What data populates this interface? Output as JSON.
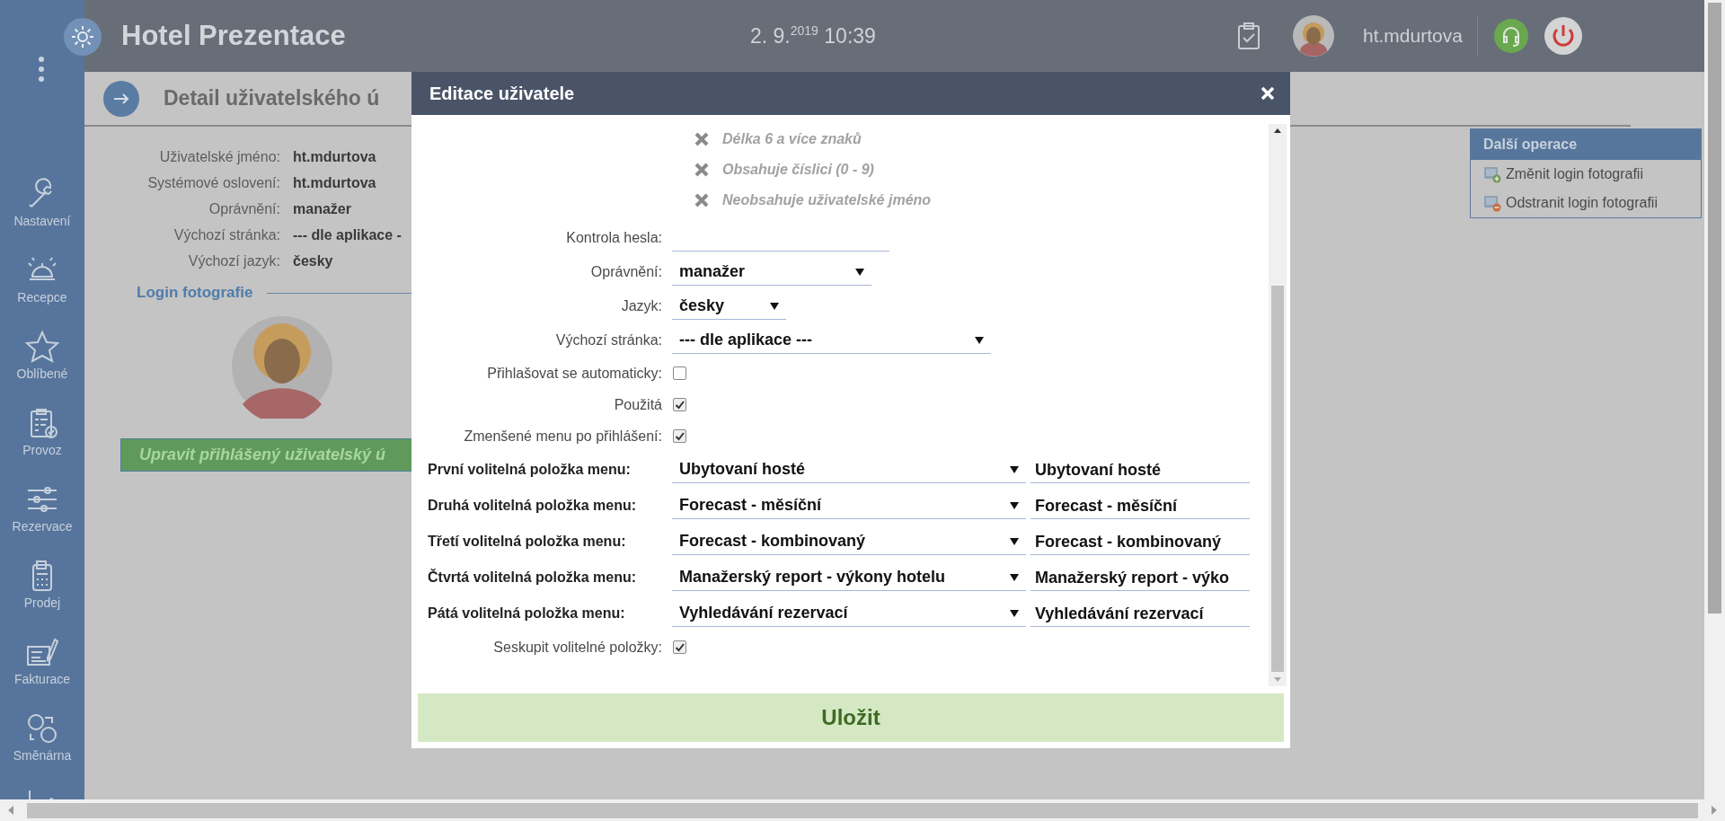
{
  "header": {
    "title": "Hotel Prezentace",
    "datetime": "2. 9.$^{2019}$ 10:39",
    "user": "ht.mdurtova"
  },
  "sidebar": {
    "items": [
      {
        "kind": "wrench",
        "label": "Nastavení"
      },
      {
        "kind": "bell",
        "label": "Recepce"
      },
      {
        "kind": "star",
        "label": "Oblíbené"
      },
      {
        "kind": "clipboard",
        "label": "Provoz"
      },
      {
        "kind": "sliders",
        "label": "Rezervace"
      },
      {
        "kind": "calculator",
        "label": "Prodej"
      },
      {
        "kind": "invoice",
        "label": "Fakturace"
      },
      {
        "kind": "exchange",
        "label": "Směnárna"
      },
      {
        "kind": "chart"
      }
    ]
  },
  "page": {
    "title": "Detail uživatelského ú",
    "fields": [
      {
        "label": "Uživatelské jméno:",
        "value": "ht.mdurtova"
      },
      {
        "label": "Systémové oslovení:",
        "value": "ht.mdurtova"
      },
      {
        "label": "Oprávnění:",
        "value": "manažer"
      },
      {
        "label": "Výchozí stránka:",
        "value": "--- dle aplikace -"
      },
      {
        "label": "Výchozí jazyk:",
        "value": "česky"
      }
    ],
    "section": "Login fotografie",
    "edit_button": "Upravit přihlášený uživatelský ú"
  },
  "panel": {
    "title": "Další operace",
    "items": [
      {
        "kind": "add",
        "label": "Změnit login fotografii"
      },
      {
        "kind": "remove",
        "label": "Odstranit login fotografii"
      }
    ]
  },
  "dialog": {
    "title": "Editace uživatele",
    "rules": [
      {
        "label": "Délka 6 a více znaků",
        "met": false
      },
      {
        "label": "Obsahuje číslici (0 - 9)",
        "met": false
      },
      {
        "label": "Neobsahuje uživatelské jméno",
        "met": false
      }
    ],
    "fields": [
      {
        "kind": "password",
        "label": "Kontrola hesla:"
      },
      {
        "kind": "select",
        "label": "Oprávnění:",
        "value": "manažer"
      },
      {
        "kind": "select",
        "label": "Jazyk:",
        "value": "česky"
      },
      {
        "kind": "select",
        "label": "Výchozí stránka:",
        "value": "--- dle aplikace ---"
      },
      {
        "kind": "checkbox",
        "label": "Přihlašovat se automaticky:",
        "checked": false
      },
      {
        "kind": "checkbox",
        "label": "Použitá",
        "checked": true
      },
      {
        "kind": "checkbox",
        "label": "Zmenšené menu po přihlášení:",
        "checked": true
      }
    ],
    "menu_items": [
      {
        "label": "První volitelná položka menu:",
        "value": "Ubytovaní hosté",
        "text": "Ubytovaní hosté"
      },
      {
        "label": "Druhá volitelná položka menu:",
        "value": "Forecast - měsíční",
        "text": "Forecast - měsíční"
      },
      {
        "label": "Třetí volitelná položka menu:",
        "value": "Forecast - kombinovaný",
        "text": "Forecast - kombinovaný"
      },
      {
        "label": "Čtvrtá volitelná položka menu:",
        "value": "Manažerský report - výkony hotelu",
        "text": "Manažerský report - výko"
      },
      {
        "label": "Pátá volitelná položka menu:",
        "value": "Vyhledávání rezervací",
        "text": "Vyhledávání rezervací"
      }
    ],
    "group": {
      "label": "Seskupit volitelné položky:",
      "checked": true
    },
    "save": "Uložit"
  }
}
